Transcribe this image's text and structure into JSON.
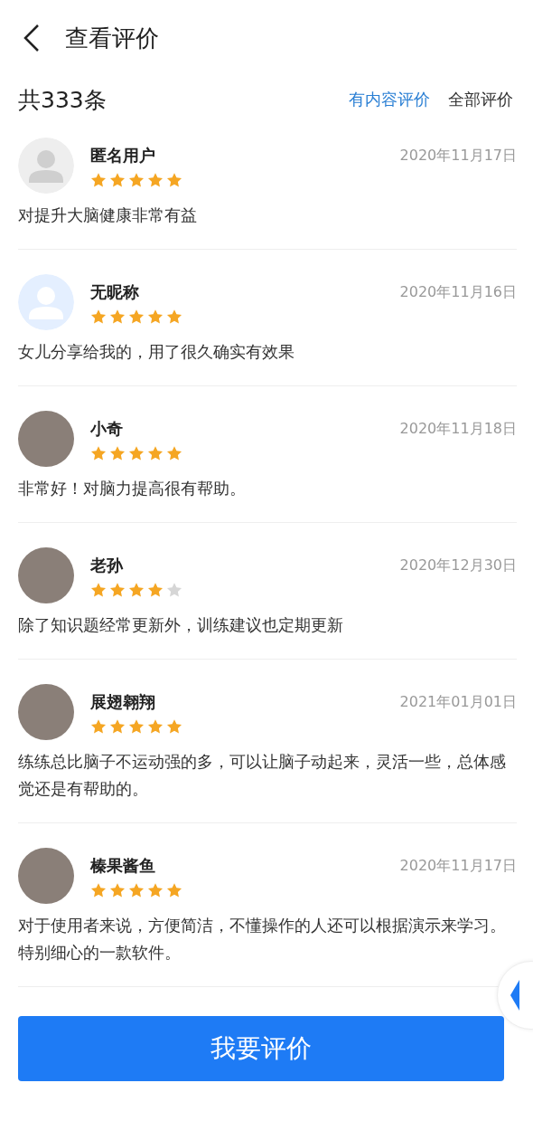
{
  "header": {
    "title": "查看评价"
  },
  "summary": {
    "count": "共333条",
    "filters": [
      {
        "label": "有内容评价",
        "selected": true
      },
      {
        "label": "全部评价",
        "selected": false
      }
    ]
  },
  "reviews": [
    {
      "kind": "silhouette-grey",
      "name": "匿名用户",
      "stars": 5,
      "date": "2020年11月17日",
      "text": "对提升大脑健康非常有益"
    },
    {
      "kind": "silhouette-blue",
      "name": "无昵称",
      "stars": 5,
      "date": "2020年11月16日",
      "text": "女儿分享给我的，用了很久确实有效果"
    },
    {
      "kind": "photo",
      "name": "小奇",
      "stars": 5,
      "date": "2020年11月18日",
      "text": "非常好！对脑力提高很有帮助。"
    },
    {
      "kind": "photo",
      "name": "老孙",
      "stars": 4,
      "date": "2020年12月30日",
      "text": "除了知识题经常更新外，训练建议也定期更新"
    },
    {
      "kind": "photo",
      "name": "展翅翱翔",
      "stars": 5,
      "date": "2021年01月01日",
      "text": "练练总比脑子不运动强的多，可以让脑子动起来，灵活一些，总体感觉还是有帮助的。"
    },
    {
      "kind": "photo",
      "name": "榛果酱鱼",
      "stars": 5,
      "date": "2020年11月17日",
      "text": "对于使用者来说，方便简洁，不懂操作的人还可以根据演示来学习。特别细心的一款软件。"
    }
  ],
  "submit_button": {
    "label": "我要评价"
  }
}
